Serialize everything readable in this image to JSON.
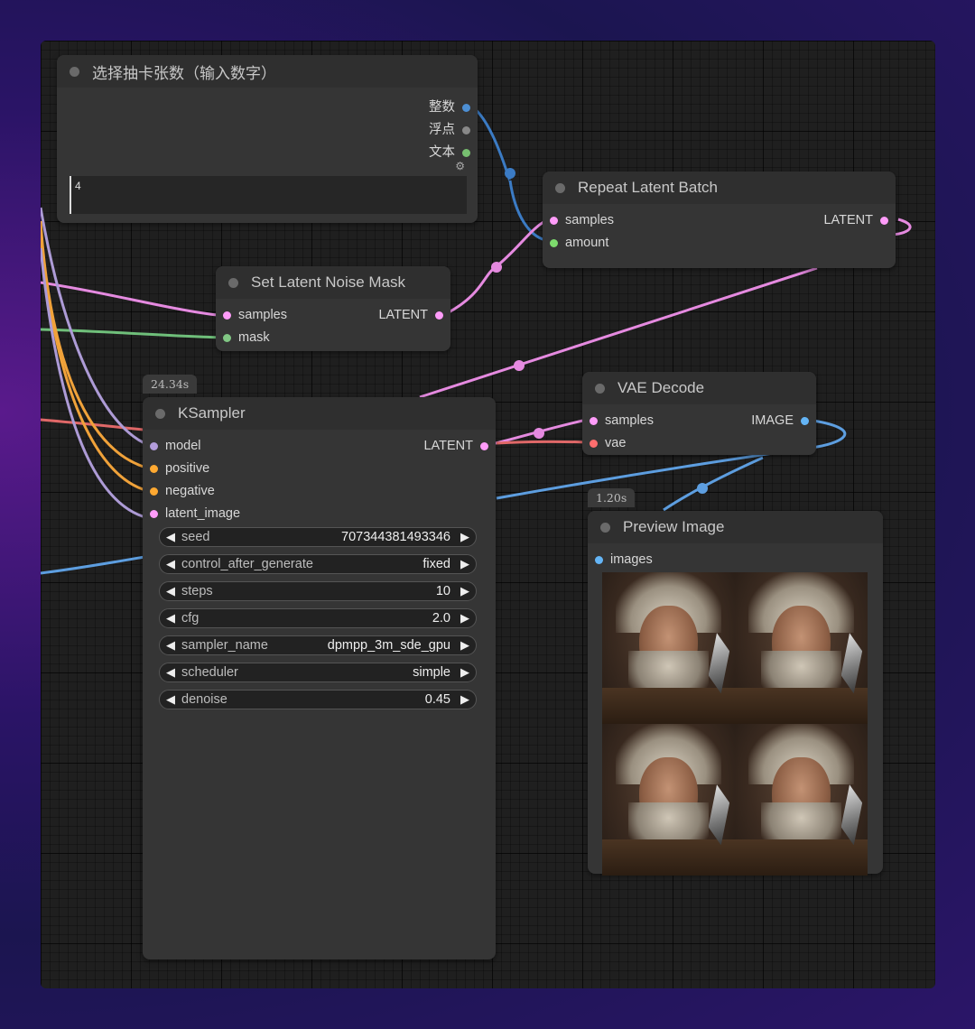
{
  "nodes": {
    "int_input": {
      "title": "选择抽卡张数（输入数字）",
      "outputs": [
        "整数",
        "浮点",
        "文本"
      ],
      "value": "4"
    },
    "repeat_latent": {
      "title": "Repeat Latent Batch",
      "inputs": [
        "samples",
        "amount"
      ],
      "output": "LATENT"
    },
    "set_noise_mask": {
      "title": "Set Latent Noise Mask",
      "inputs": [
        "samples",
        "mask"
      ],
      "output": "LATENT"
    },
    "ksampler": {
      "title": "KSampler",
      "time": "24.34s",
      "inputs": [
        "model",
        "positive",
        "negative",
        "latent_image"
      ],
      "output": "LATENT",
      "widgets": [
        {
          "label": "seed",
          "value": "707344381493346"
        },
        {
          "label": "control_after_generate",
          "value": "fixed"
        },
        {
          "label": "steps",
          "value": "10"
        },
        {
          "label": "cfg",
          "value": "2.0"
        },
        {
          "label": "sampler_name",
          "value": "dpmpp_3m_sde_gpu"
        },
        {
          "label": "scheduler",
          "value": "simple"
        },
        {
          "label": "denoise",
          "value": "0.45"
        }
      ]
    },
    "vae_decode": {
      "title": "VAE Decode",
      "inputs": [
        "samples",
        "vae"
      ],
      "output": "IMAGE"
    },
    "preview": {
      "title": "Preview Image",
      "time": "1.20s",
      "inputs": [
        "images"
      ]
    }
  },
  "colors": {
    "latent": "#ff9cf9",
    "int": "#4d8fd4",
    "model": "#b39ddb",
    "conditioning": "#ffa931",
    "mask": "#81c784",
    "vae": "#ff6e6e",
    "image": "#64b5f6",
    "float": "#aaaaaa",
    "string": "#77c070"
  }
}
